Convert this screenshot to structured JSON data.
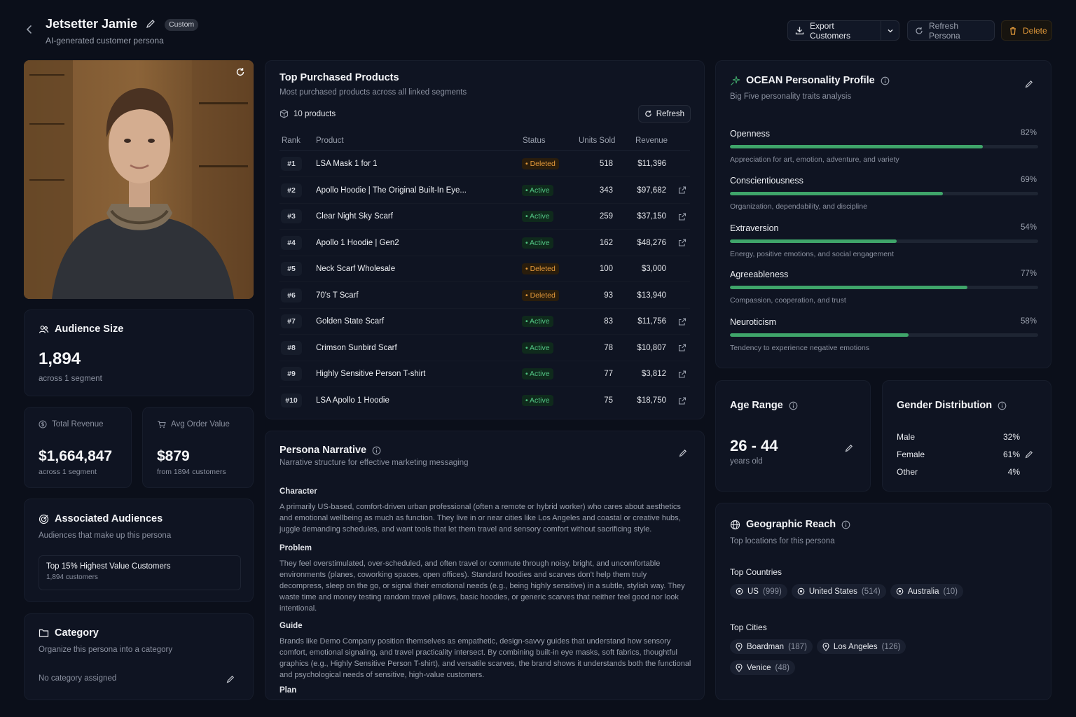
{
  "header": {
    "title": "Jetsetter Jamie",
    "badge": "Custom",
    "subtitle": "AI-generated customer persona",
    "export_label": "Export Customers",
    "refresh_label": "Refresh Persona",
    "delete_label": "Delete"
  },
  "audience": {
    "title": "Audience Size",
    "value": "1,894",
    "caption": "across 1 segment"
  },
  "total_revenue": {
    "title": "Total Revenue",
    "value": "$1,664,847",
    "caption": "across 1 segment"
  },
  "avg_order": {
    "title": "Avg Order Value",
    "value": "$879",
    "caption": "from 1894 customers"
  },
  "associated": {
    "title": "Associated Audiences",
    "subtitle": "Audiences that make up this persona",
    "items": [
      {
        "name": "Top 15% Highest Value Customers",
        "count": "1,894 customers"
      }
    ]
  },
  "category": {
    "title": "Category",
    "subtitle": "Organize this persona into a category",
    "value": "No category assigned"
  },
  "products": {
    "title": "Top Purchased Products",
    "subtitle": "Most purchased products across all linked segments",
    "count_label": "10 products",
    "refresh_label": "Refresh",
    "columns": {
      "rank": "Rank",
      "product": "Product",
      "status": "Status",
      "units": "Units Sold",
      "revenue": "Revenue"
    },
    "rows": [
      {
        "rank": "#1",
        "name": "LSA Mask 1 for 1",
        "status": "Deleted",
        "units": "518",
        "revenue": "$11,396",
        "link": false
      },
      {
        "rank": "#2",
        "name": "Apollo Hoodie | The Original Built-In Eye...",
        "status": "Active",
        "units": "343",
        "revenue": "$97,682",
        "link": true
      },
      {
        "rank": "#3",
        "name": "Clear Night Sky Scarf",
        "status": "Active",
        "units": "259",
        "revenue": "$37,150",
        "link": true
      },
      {
        "rank": "#4",
        "name": "Apollo 1 Hoodie | Gen2",
        "status": "Active",
        "units": "162",
        "revenue": "$48,276",
        "link": true
      },
      {
        "rank": "#5",
        "name": "Neck Scarf Wholesale",
        "status": "Deleted",
        "units": "100",
        "revenue": "$3,000",
        "link": false
      },
      {
        "rank": "#6",
        "name": "70's T Scarf",
        "status": "Deleted",
        "units": "93",
        "revenue": "$13,940",
        "link": false
      },
      {
        "rank": "#7",
        "name": "Golden State Scarf",
        "status": "Active",
        "units": "83",
        "revenue": "$11,756",
        "link": true
      },
      {
        "rank": "#8",
        "name": "Crimson Sunbird Scarf",
        "status": "Active",
        "units": "78",
        "revenue": "$10,807",
        "link": true
      },
      {
        "rank": "#9",
        "name": "Highly Sensitive Person T-shirt",
        "status": "Active",
        "units": "77",
        "revenue": "$3,812",
        "link": true
      },
      {
        "rank": "#10",
        "name": "LSA Apollo 1 Hoodie",
        "status": "Active",
        "units": "75",
        "revenue": "$18,750",
        "link": true
      }
    ]
  },
  "narrative": {
    "title": "Persona Narrative",
    "subtitle": "Narrative structure for effective marketing messaging",
    "sections": [
      {
        "heading": "Character",
        "text": "A primarily US-based, comfort-driven urban professional (often a remote or hybrid worker) who cares about aesthetics and emotional wellbeing as much as function. They live in or near cities like Los Angeles and coastal or creative hubs, juggle demanding schedules, and want tools that let them travel and sensory comfort without sacrificing style."
      },
      {
        "heading": "Problem",
        "text": "They feel overstimulated, over-scheduled, and often travel or commute through noisy, bright, and uncomfortable environments (planes, coworking spaces, open offices). Standard hoodies and scarves don't help them truly decompress, sleep on the go, or signal their emotional needs (e.g., being highly sensitive) in a subtle, stylish way. They waste time and money testing random travel pillows, basic hoodies, or generic scarves that neither feel good nor look intentional."
      },
      {
        "heading": "Guide",
        "text": "Brands like Demo Company position themselves as empathetic, design-savvy guides that understand how sensory comfort, emotional signaling, and travel practicality intersect. By combining built-in eye masks, soft fabrics, thoughtful graphics (e.g., Highly Sensitive Person T-shirt), and versatile scarves, the brand shows it understands both the functional and psychological needs of sensitive, high-value customers."
      },
      {
        "heading": "Plan",
        "text": ""
      }
    ]
  },
  "ocean": {
    "title": "OCEAN Personality Profile",
    "subtitle": "Big Five personality traits analysis",
    "traits": [
      {
        "name": "Openness",
        "value": 82,
        "label": "82%",
        "desc": "Appreciation for art, emotion, adventure, and variety"
      },
      {
        "name": "Conscientiousness",
        "value": 69,
        "label": "69%",
        "desc": "Organization, dependability, and discipline"
      },
      {
        "name": "Extraversion",
        "value": 54,
        "label": "54%",
        "desc": "Energy, positive emotions, and social engagement"
      },
      {
        "name": "Agreeableness",
        "value": 77,
        "label": "77%",
        "desc": "Compassion, cooperation, and trust"
      },
      {
        "name": "Neuroticism",
        "value": 58,
        "label": "58%",
        "desc": "Tendency to experience negative emotions"
      }
    ]
  },
  "age": {
    "title": "Age Range",
    "value": "26 - 44",
    "caption": "years old"
  },
  "gender": {
    "title": "Gender Distribution",
    "rows": [
      {
        "label": "Male",
        "value": "32%"
      },
      {
        "label": "Female",
        "value": "61%"
      },
      {
        "label": "Other",
        "value": "4%"
      }
    ]
  },
  "geo": {
    "title": "Geographic Reach",
    "subtitle": "Top locations for this persona",
    "countries_label": "Top Countries",
    "countries": [
      {
        "name": "US",
        "count": "(999)"
      },
      {
        "name": "United States",
        "count": "(514)"
      },
      {
        "name": "Australia",
        "count": "(10)"
      }
    ],
    "cities_label": "Top Cities",
    "cities": [
      {
        "name": "Boardman",
        "count": "(187)"
      },
      {
        "name": "Los Angeles",
        "count": "(126)"
      },
      {
        "name": "Venice",
        "count": "(48)"
      }
    ]
  },
  "colors": {
    "active": "#52c584",
    "deleted": "#e59a3a",
    "bar": "#3fa56a"
  }
}
